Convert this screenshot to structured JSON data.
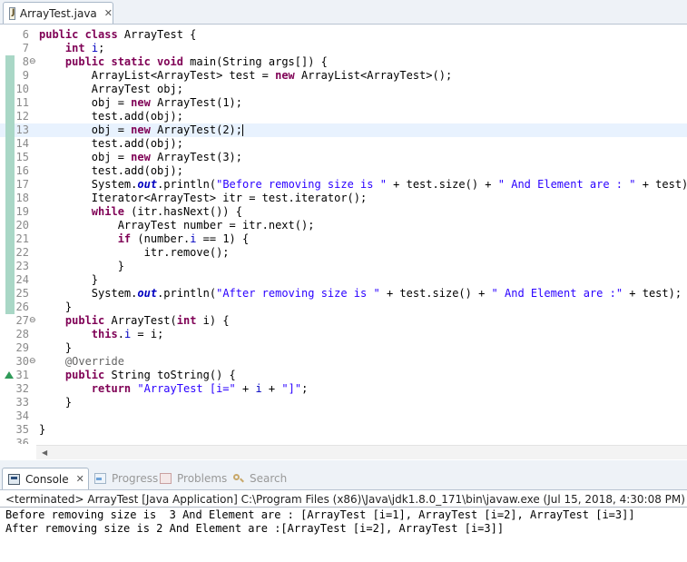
{
  "editor_tab": {
    "label": "ArrayTest.java",
    "close_glyph": "✕"
  },
  "gutter_fold_glyph": "⊖",
  "lines": [
    {
      "n": "6",
      "code": "<span class=\"kw\">public class</span> ArrayTest {"
    },
    {
      "n": "7",
      "code": "    <span class=\"kw\">int</span> <span class=\"fld\">i</span>;"
    },
    {
      "n": "8",
      "fold": true,
      "bar": true,
      "code": "    <span class=\"kw\">public static void</span> main(String args[]) {"
    },
    {
      "n": "9",
      "bar": true,
      "code": "        ArrayList&lt;ArrayTest&gt; test = <span class=\"kw\">new</span> ArrayList&lt;ArrayTest&gt;();"
    },
    {
      "n": "10",
      "bar": true,
      "code": "        ArrayTest obj;"
    },
    {
      "n": "11",
      "bar": true,
      "code": "        obj = <span class=\"kw\">new</span> ArrayTest(1);"
    },
    {
      "n": "12",
      "bar": true,
      "code": "        test.add(obj);"
    },
    {
      "n": "13",
      "bar": true,
      "current": true,
      "caret": true,
      "code": "        obj = <span class=\"kw\">new</span> ArrayTest(2);"
    },
    {
      "n": "14",
      "bar": true,
      "code": "        test.add(obj);"
    },
    {
      "n": "15",
      "bar": true,
      "code": "        obj = <span class=\"kw\">new</span> ArrayTest(3);"
    },
    {
      "n": "16",
      "bar": true,
      "code": "        test.add(obj);"
    },
    {
      "n": "17",
      "bar": true,
      "code": "        System.<span class=\"sfld\">out</span>.println(<span class=\"str\">\"Before removing size is \"</span> + test.size() + <span class=\"str\">\" And Element are : \"</span> + test);"
    },
    {
      "n": "18",
      "bar": true,
      "code": "        Iterator&lt;ArrayTest&gt; itr = test.iterator();"
    },
    {
      "n": "19",
      "bar": true,
      "code": "        <span class=\"kw\">while</span> (itr.hasNext()) {"
    },
    {
      "n": "20",
      "bar": true,
      "code": "            ArrayTest number = itr.next();"
    },
    {
      "n": "21",
      "bar": true,
      "code": "            <span class=\"kw\">if</span> (number.<span class=\"fld\">i</span> == 1) {"
    },
    {
      "n": "22",
      "bar": true,
      "code": "                itr.remove();"
    },
    {
      "n": "23",
      "bar": true,
      "code": "            }"
    },
    {
      "n": "24",
      "bar": true,
      "code": "        }"
    },
    {
      "n": "25",
      "bar": true,
      "code": "        System.<span class=\"sfld\">out</span>.println(<span class=\"str\">\"After removing size is \"</span> + test.size() + <span class=\"str\">\" And Element are :\"</span> + test);"
    },
    {
      "n": "26",
      "bar": true,
      "code": "    }"
    },
    {
      "n": "27",
      "fold": true,
      "code": "    <span class=\"kw\">public</span> ArrayTest(<span class=\"kw\">int</span> i) {"
    },
    {
      "n": "28",
      "code": "        <span class=\"kw\">this</span>.<span class=\"fld\">i</span> = i;"
    },
    {
      "n": "29",
      "code": "    }"
    },
    {
      "n": "30",
      "fold": true,
      "code": "    <span class=\"ann\">@Override</span>"
    },
    {
      "n": "31",
      "override": true,
      "code": "    <span class=\"kw\">public</span> String toString() {"
    },
    {
      "n": "32",
      "code": "        <span class=\"kw\">return</span> <span class=\"str\">\"ArrayTest [i=\"</span> + <span class=\"fld\">i</span> + <span class=\"str\">\"]\"</span>;"
    },
    {
      "n": "33",
      "code": "    }"
    },
    {
      "n": "34",
      "code": ""
    },
    {
      "n": "35",
      "code": "}"
    },
    {
      "n": "36",
      "code": ""
    }
  ],
  "console": {
    "tabs": [
      {
        "label": "Console",
        "icon": "console-icon",
        "active": true
      },
      {
        "label": "Progress",
        "icon": "progress-icon"
      },
      {
        "label": "Problems",
        "icon": "problems-icon"
      },
      {
        "label": "Search",
        "icon": "search-icon"
      }
    ],
    "close_glyph": "✕",
    "status": "<terminated> ArrayTest [Java Application] C:\\Program Files (x86)\\Java\\jdk1.8.0_171\\bin\\javaw.exe (Jul 15, 2018, 4:30:08 PM)",
    "output": [
      "Before removing size is  3 And Element are : [ArrayTest [i=1], ArrayTest [i=2], ArrayTest [i=3]]",
      "After removing size is 2 And Element are :[ArrayTest [i=2], ArrayTest [i=3]]"
    ]
  }
}
